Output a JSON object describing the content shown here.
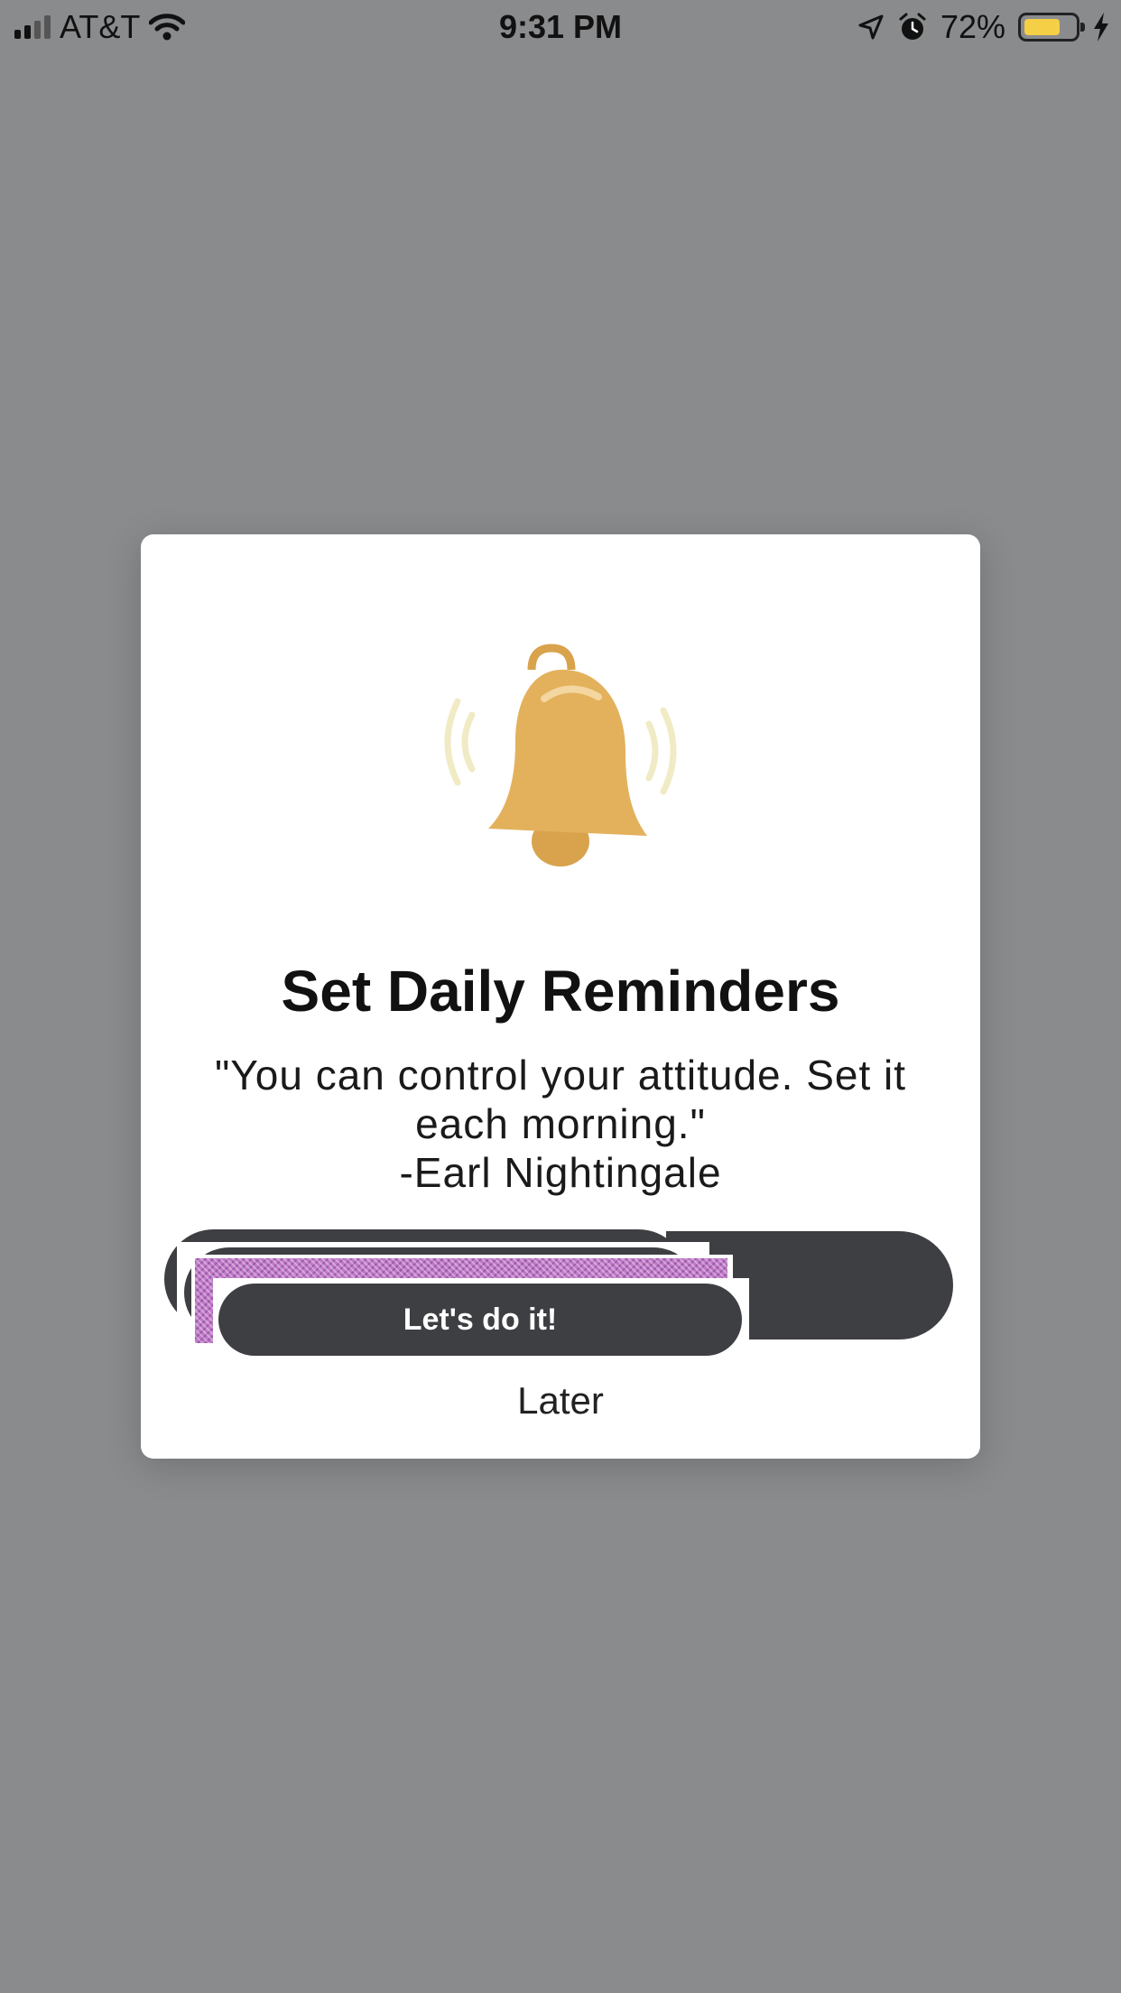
{
  "status_bar": {
    "carrier": "AT&T",
    "time": "9:31 PM",
    "battery_percent": "72%",
    "battery_level": 0.72,
    "battery_color": "#f5cf45",
    "icons": [
      "signal-icon",
      "wifi-icon",
      "location-icon",
      "alarm-icon",
      "battery-icon",
      "charging-icon"
    ]
  },
  "modal": {
    "icon": "bell-icon",
    "title": "Set Daily Reminders",
    "quote": "\"You can control your attitude. Set it each morning.\"",
    "author": "-Earl Nightingale",
    "primary_button": "Let's do it!",
    "secondary_button": "Later"
  },
  "colors": {
    "overlay": "#8a8b8d",
    "button": "#3e3f42",
    "bell": "#e3b15c",
    "waves": "#f0ebc4"
  }
}
